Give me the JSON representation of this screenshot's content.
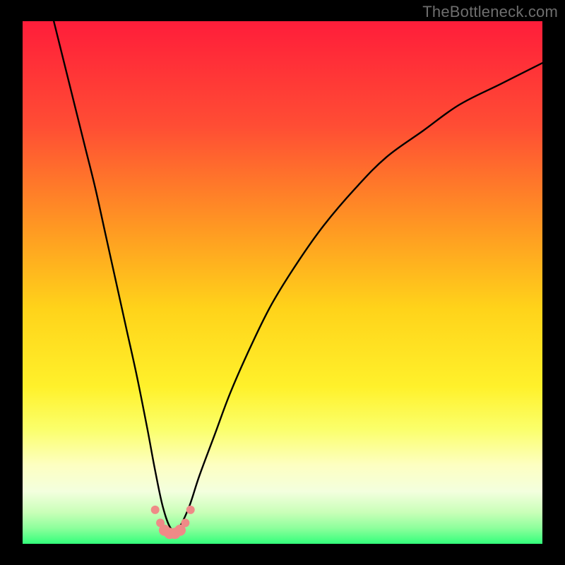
{
  "watermark": "TheBottleneck.com",
  "chart_data": {
    "type": "line",
    "title": "",
    "xlabel": "",
    "ylabel": "",
    "xlim": [
      0,
      100
    ],
    "ylim": [
      0,
      100
    ],
    "grid": false,
    "legend": false,
    "background_gradient": {
      "stops": [
        {
          "offset": 0.0,
          "color": "#ff1d3a"
        },
        {
          "offset": 0.2,
          "color": "#ff4d34"
        },
        {
          "offset": 0.4,
          "color": "#ff9a22"
        },
        {
          "offset": 0.55,
          "color": "#ffd31a"
        },
        {
          "offset": 0.7,
          "color": "#fff12b"
        },
        {
          "offset": 0.78,
          "color": "#fbff6a"
        },
        {
          "offset": 0.85,
          "color": "#fdffc2"
        },
        {
          "offset": 0.9,
          "color": "#f3ffde"
        },
        {
          "offset": 0.94,
          "color": "#c9ffb8"
        },
        {
          "offset": 0.97,
          "color": "#8dff9c"
        },
        {
          "offset": 1.0,
          "color": "#33ff7b"
        }
      ]
    },
    "series": [
      {
        "name": "bottleneck-curve",
        "color": "#000000",
        "x": [
          6,
          8,
          10,
          12,
          14,
          16,
          18,
          20,
          22,
          24,
          25.5,
          27,
          28.5,
          30,
          32,
          34,
          37,
          40,
          44,
          48,
          53,
          58,
          64,
          70,
          77,
          84,
          92,
          100
        ],
        "y": [
          100,
          92,
          84,
          76,
          68,
          59,
          50,
          41,
          32,
          22,
          14,
          7,
          3,
          3,
          7,
          13,
          21,
          29,
          38,
          46,
          54,
          61,
          68,
          74,
          79,
          84,
          88,
          92
        ]
      }
    ],
    "markers": {
      "name": "min-region-markers",
      "color": "#ef8a87",
      "radius_small": 6,
      "radius_large": 8,
      "points": [
        {
          "x": 25.5,
          "y": 6.5,
          "r": "small"
        },
        {
          "x": 26.5,
          "y": 4.0,
          "r": "small"
        },
        {
          "x": 27.3,
          "y": 2.6,
          "r": "large"
        },
        {
          "x": 28.3,
          "y": 2.0,
          "r": "large"
        },
        {
          "x": 29.3,
          "y": 2.0,
          "r": "large"
        },
        {
          "x": 30.3,
          "y": 2.6,
          "r": "large"
        },
        {
          "x": 31.3,
          "y": 4.0,
          "r": "small"
        },
        {
          "x": 32.3,
          "y": 6.5,
          "r": "small"
        }
      ]
    }
  }
}
